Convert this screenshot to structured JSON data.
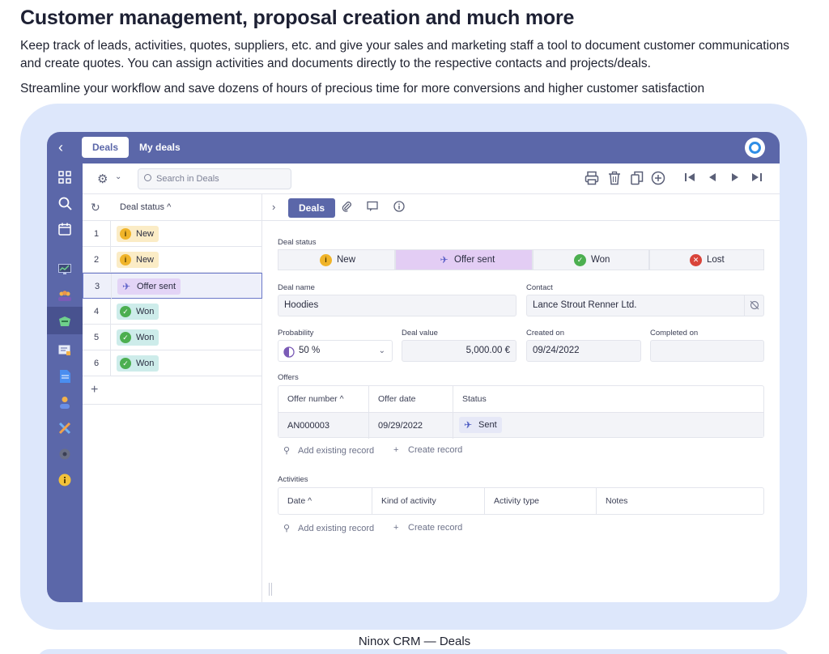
{
  "heading": "Customer management, proposal creation and much more",
  "paragraph1": "Keep track of leads, activities, quotes, suppliers, etc. and give your sales and marketing staff a tool to document customer communications and create quotes. You can assign activities and documents directly to the respective contacts and projects/deals.",
  "paragraph2": "Streamline your workflow and save dozens of hours of precious time for more conversions and higher customer satisfaction",
  "caption": "Ninox CRM — Deals",
  "app": {
    "tabs": [
      "Deals",
      "My deals"
    ],
    "search_placeholder": "Search in Deals",
    "list_header": "Deal status ^",
    "rows": [
      {
        "num": "1",
        "status": "New",
        "kind": "new",
        "icon": "i"
      },
      {
        "num": "2",
        "status": "New",
        "kind": "new",
        "icon": "i"
      },
      {
        "num": "3",
        "status": "Offer sent",
        "kind": "offer",
        "icon": "✓"
      },
      {
        "num": "4",
        "status": "Won",
        "kind": "won",
        "icon": "✓"
      },
      {
        "num": "5",
        "status": "Won",
        "kind": "won",
        "icon": "✓"
      },
      {
        "num": "6",
        "status": "Won",
        "kind": "won",
        "icon": "✓"
      }
    ],
    "selected_row": "3",
    "detail_tab": "Deals",
    "deal_status_label": "Deal status",
    "status_options": [
      "New",
      "Offer sent",
      "Won",
      "Lost"
    ],
    "selected_status": "Offer sent",
    "deal_name_label": "Deal name",
    "deal_name": "Hoodies",
    "contact_label": "Contact",
    "contact": "Lance Strout Renner Ltd.",
    "probability_label": "Probability",
    "probability": "50 %",
    "deal_value_label": "Deal value",
    "deal_value": "5,000.00 €",
    "created_on_label": "Created on",
    "created_on": "09/24/2022",
    "completed_on_label": "Completed on",
    "completed_on": "",
    "offers_label": "Offers",
    "offers_headers": [
      "Offer number ^",
      "Offer date",
      "Status"
    ],
    "offers_row": {
      "number": "AN000003",
      "date": "09/29/2022",
      "status": "Sent"
    },
    "add_existing": "Add existing record",
    "create_record": "Create record",
    "activities_label": "Activities",
    "activities_headers": [
      "Date ^",
      "Kind of activity",
      "Activity type",
      "Notes"
    ]
  },
  "colors": {
    "brand": "#5b67a9",
    "backdrop": "#dde7fb",
    "new": "#f0b429",
    "won": "#4caf50",
    "lost": "#d9443a",
    "offer_sent": "#e3cdf4"
  }
}
